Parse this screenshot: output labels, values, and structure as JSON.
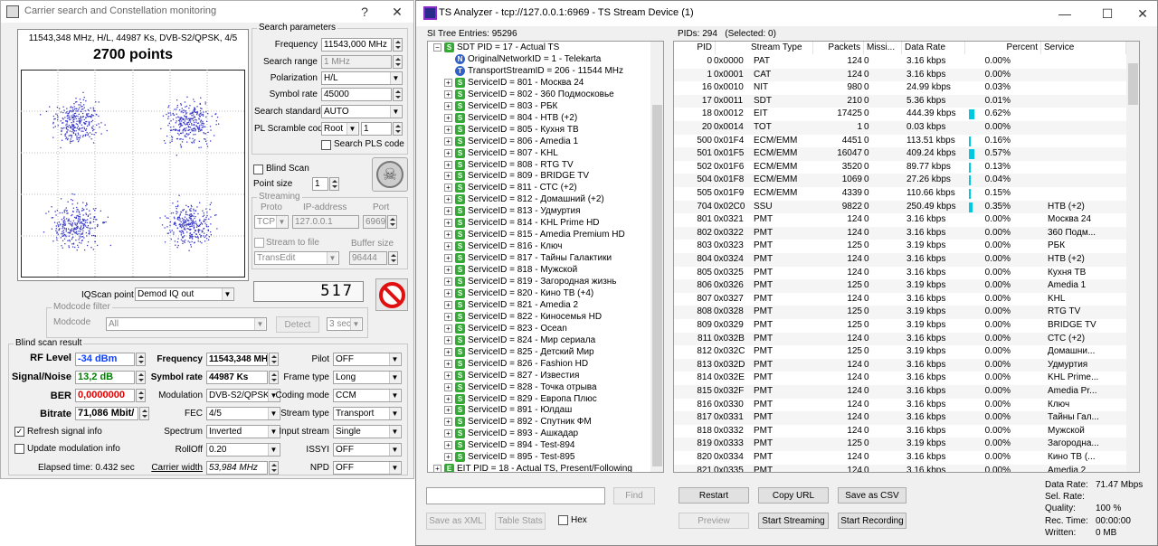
{
  "left": {
    "title": "Carrier search and Constellation monitoring",
    "help": "?",
    "close": "✕",
    "const_info": "11543,348 MHz, H/L, 44987 Ks, DVB-S2/QPSK, 4/5",
    "const_points": "2700 points",
    "search_title": "Search parameters",
    "freq_label": "Frequency",
    "freq_value": "11543,000 MHz",
    "range_label": "Search range",
    "range_value": "1 MHz",
    "pol_label": "Polarization",
    "pol_value": "H/L",
    "sr_label": "Symbol rate",
    "sr_value": "45000",
    "std_label": "Search standard",
    "std_value": "AUTO",
    "pls_label": "PL Scramble code",
    "pls_value": "Root",
    "pls_num": "1",
    "search_pls": "Search PLS code",
    "blind_scan": "Blind Scan",
    "point_size_label": "Point size",
    "point_size_value": "1",
    "streaming_title": "Streaming",
    "proto_label": "Proto",
    "ip_label": "IP-address",
    "port_label": "Port",
    "proto_value": "TCP",
    "ip_value": "127.0.0.1",
    "port_value": "6969",
    "stream_file": "Stream to file",
    "buffer_label": "Buffer size",
    "file_value": "TransEdit",
    "buffer_value": "96444",
    "iq_label": "IQScan point",
    "iq_value": "Demod IQ out",
    "counter": "517",
    "modcode_title": "Modcode filter",
    "modcode_label": "Modcode",
    "modcode_value": "All",
    "detect": "Detect",
    "sec_value": "3 sec",
    "blind_title": "Blind scan result",
    "rf_label": "RF Level",
    "rf_value": "-34 dBm",
    "sn_label": "Signal/Noise",
    "sn_value": "13,2 dB",
    "ber_label": "BER",
    "ber_value": "0,0000000",
    "bitrate_label": "Bitrate",
    "bitrate_value": "71,086 Mbit/",
    "bfreq_label": "Frequency",
    "bfreq_value": "11543,348 MH",
    "bsr_label": "Symbol rate",
    "bsr_value": "44987 Ks",
    "mod_label": "Modulation",
    "mod_value": "DVB-S2/QPSK",
    "fec_label": "FEC",
    "fec_value": "4/5",
    "spectrum_label": "Spectrum",
    "spectrum_value": "Inverted",
    "rolloff_label": "RollOff",
    "rolloff_value": "0.20",
    "cw_label": "Carrier width",
    "cw_value": "53,984 MHz",
    "pilot_label": "Pilot",
    "pilot_value": "OFF",
    "frame_label": "Frame type",
    "frame_value": "Long",
    "coding_label": "Coding mode",
    "coding_value": "CCM",
    "stype_label": "Stream type",
    "stype_value": "Transport",
    "istream_label": "Input stream",
    "istream_value": "Single",
    "issyi_label": "ISSYI",
    "issyi_value": "OFF",
    "npd_label": "NPD",
    "npd_value": "OFF",
    "refresh": "Refresh signal info",
    "update": "Update modulation info",
    "elapsed": "Elapsed time: 0.432 sec"
  },
  "right": {
    "title": "TS Analyzer - tcp://127.0.0.1:6969 - TS Stream Device (1)",
    "si_entries": "SI Tree Entries: 95296",
    "pids_info": "PIDs: 294   (Selected: 0)",
    "tree": [
      {
        "level": 0,
        "pm": "−",
        "icon": "S",
        "text": "SDT PID = 17 - Actual TS"
      },
      {
        "level": 1,
        "pm": "",
        "icon": "N",
        "text": "OriginalNetworkID = 1 - Telekarta"
      },
      {
        "level": 1,
        "pm": "",
        "icon": "T",
        "text": "TransportStreamID = 206 - 11544 MHz"
      },
      {
        "level": 1,
        "pm": "+",
        "icon": "S",
        "text": "ServiceID = 801 - Москва 24"
      },
      {
        "level": 1,
        "pm": "+",
        "icon": "S",
        "text": "ServiceID = 802 - 360 Подмосковье"
      },
      {
        "level": 1,
        "pm": "+",
        "icon": "S",
        "text": "ServiceID = 803 - РБК"
      },
      {
        "level": 1,
        "pm": "+",
        "icon": "S",
        "text": "ServiceID = 804 - НТВ (+2)"
      },
      {
        "level": 1,
        "pm": "+",
        "icon": "S",
        "text": "ServiceID = 805 - Кухня ТВ"
      },
      {
        "level": 1,
        "pm": "+",
        "icon": "S",
        "text": "ServiceID = 806 - Amedia 1"
      },
      {
        "level": 1,
        "pm": "+",
        "icon": "S",
        "text": "ServiceID = 807 - KHL"
      },
      {
        "level": 1,
        "pm": "+",
        "icon": "S",
        "text": "ServiceID = 808 - RTG TV"
      },
      {
        "level": 1,
        "pm": "+",
        "icon": "S",
        "text": "ServiceID = 809 - BRIDGE TV"
      },
      {
        "level": 1,
        "pm": "+",
        "icon": "S",
        "text": "ServiceID = 811 - СТС (+2)"
      },
      {
        "level": 1,
        "pm": "+",
        "icon": "S",
        "text": "ServiceID = 812 - Домашний (+2)"
      },
      {
        "level": 1,
        "pm": "+",
        "icon": "S",
        "text": "ServiceID = 813 - Удмуртия"
      },
      {
        "level": 1,
        "pm": "+",
        "icon": "S",
        "text": "ServiceID = 814 - KHL Prime HD"
      },
      {
        "level": 1,
        "pm": "+",
        "icon": "S",
        "text": "ServiceID = 815 - Amedia Premium HD"
      },
      {
        "level": 1,
        "pm": "+",
        "icon": "S",
        "text": "ServiceID = 816 - Ключ"
      },
      {
        "level": 1,
        "pm": "+",
        "icon": "S",
        "text": "ServiceID = 817 - Тайны Галактики"
      },
      {
        "level": 1,
        "pm": "+",
        "icon": "S",
        "text": "ServiceID = 818 - Мужской"
      },
      {
        "level": 1,
        "pm": "+",
        "icon": "S",
        "text": "ServiceID = 819 - Загородная жизнь"
      },
      {
        "level": 1,
        "pm": "+",
        "icon": "S",
        "text": "ServiceID = 820 - Кино ТВ (+4)"
      },
      {
        "level": 1,
        "pm": "+",
        "icon": "S",
        "text": "ServiceID = 821 - Amedia 2"
      },
      {
        "level": 1,
        "pm": "+",
        "icon": "S",
        "text": "ServiceID = 822 - Киносемья HD"
      },
      {
        "level": 1,
        "pm": "+",
        "icon": "S",
        "text": "ServiceID = 823 - Ocean"
      },
      {
        "level": 1,
        "pm": "+",
        "icon": "S",
        "text": "ServiceID = 824 - Мир сериала"
      },
      {
        "level": 1,
        "pm": "+",
        "icon": "S",
        "text": "ServiceID = 825 - Детский Мир"
      },
      {
        "level": 1,
        "pm": "+",
        "icon": "S",
        "text": "ServiceID = 826 - Fashion HD"
      },
      {
        "level": 1,
        "pm": "+",
        "icon": "S",
        "text": "ServiceID = 827 - Известия"
      },
      {
        "level": 1,
        "pm": "+",
        "icon": "S",
        "text": "ServiceID = 828 - Точка отрыва"
      },
      {
        "level": 1,
        "pm": "+",
        "icon": "S",
        "text": "ServiceID = 829 - Европа Плюс"
      },
      {
        "level": 1,
        "pm": "+",
        "icon": "S",
        "text": "ServiceID = 891 - Юлдаш"
      },
      {
        "level": 1,
        "pm": "+",
        "icon": "S",
        "text": "ServiceID = 892 - Спутник ФМ"
      },
      {
        "level": 1,
        "pm": "+",
        "icon": "S",
        "text": "ServiceID = 893 - Ашкадар"
      },
      {
        "level": 1,
        "pm": "+",
        "icon": "S",
        "text": "ServiceID = 894 - Test-894"
      },
      {
        "level": 1,
        "pm": "+",
        "icon": "S",
        "text": "ServiceID = 895 - Test-895"
      },
      {
        "level": 0,
        "pm": "+",
        "icon": "E",
        "text": "EIT PID = 18 - Actual TS, Present/Following"
      }
    ],
    "cols": [
      "PID",
      "",
      "Stream Type",
      "Packets",
      "Missi...",
      "Data Rate",
      "Percent",
      "Service"
    ],
    "rows": [
      [
        "0",
        "0x0000",
        "PAT",
        "124",
        "0",
        "3.16 kbps",
        "0.00%",
        "",
        0
      ],
      [
        "1",
        "0x0001",
        "CAT",
        "124",
        "0",
        "3.16 kbps",
        "0.00%",
        "",
        0
      ],
      [
        "16",
        "0x0010",
        "NIT",
        "980",
        "0",
        "24.99 kbps",
        "0.03%",
        "",
        0
      ],
      [
        "17",
        "0x0011",
        "SDT",
        "210",
        "0",
        "5.36 kbps",
        "0.01%",
        "",
        0
      ],
      [
        "18",
        "0x0012",
        "EIT",
        "17425",
        "0",
        "444.39 kbps",
        "0.62%",
        "",
        0.62
      ],
      [
        "20",
        "0x0014",
        "TOT",
        "1",
        "0",
        "0.03 kbps",
        "0.00%",
        "",
        0
      ],
      [
        "500",
        "0x01F4",
        "ECM/EMM",
        "4451",
        "0",
        "113.51 kbps",
        "0.16%",
        "",
        0.16
      ],
      [
        "501",
        "0x01F5",
        "ECM/EMM",
        "16047",
        "0",
        "409.24 kbps",
        "0.57%",
        "",
        0.57
      ],
      [
        "502",
        "0x01F6",
        "ECM/EMM",
        "3520",
        "0",
        "89.77 kbps",
        "0.13%",
        "",
        0.13
      ],
      [
        "504",
        "0x01F8",
        "ECM/EMM",
        "1069",
        "0",
        "27.26 kbps",
        "0.04%",
        "",
        0.04
      ],
      [
        "505",
        "0x01F9",
        "ECM/EMM",
        "4339",
        "0",
        "110.66 kbps",
        "0.15%",
        "",
        0.15
      ],
      [
        "704",
        "0x02C0",
        "SSU",
        "9822",
        "0",
        "250.49 kbps",
        "0.35%",
        "НТВ (+2)",
        0.35
      ],
      [
        "801",
        "0x0321",
        "PMT",
        "124",
        "0",
        "3.16 kbps",
        "0.00%",
        "Москва 24",
        0
      ],
      [
        "802",
        "0x0322",
        "PMT",
        "124",
        "0",
        "3.16 kbps",
        "0.00%",
        "360 Подм...",
        0
      ],
      [
        "803",
        "0x0323",
        "PMT",
        "125",
        "0",
        "3.19 kbps",
        "0.00%",
        "РБК",
        0
      ],
      [
        "804",
        "0x0324",
        "PMT",
        "124",
        "0",
        "3.16 kbps",
        "0.00%",
        "НТВ (+2)",
        0
      ],
      [
        "805",
        "0x0325",
        "PMT",
        "124",
        "0",
        "3.16 kbps",
        "0.00%",
        "Кухня ТВ",
        0
      ],
      [
        "806",
        "0x0326",
        "PMT",
        "125",
        "0",
        "3.19 kbps",
        "0.00%",
        "Amedia 1",
        0
      ],
      [
        "807",
        "0x0327",
        "PMT",
        "124",
        "0",
        "3.16 kbps",
        "0.00%",
        "KHL",
        0
      ],
      [
        "808",
        "0x0328",
        "PMT",
        "125",
        "0",
        "3.19 kbps",
        "0.00%",
        "RTG TV",
        0
      ],
      [
        "809",
        "0x0329",
        "PMT",
        "125",
        "0",
        "3.19 kbps",
        "0.00%",
        "BRIDGE TV",
        0
      ],
      [
        "811",
        "0x032B",
        "PMT",
        "124",
        "0",
        "3.16 kbps",
        "0.00%",
        "СТС (+2)",
        0
      ],
      [
        "812",
        "0x032C",
        "PMT",
        "125",
        "0",
        "3.19 kbps",
        "0.00%",
        "Домашни...",
        0
      ],
      [
        "813",
        "0x032D",
        "PMT",
        "124",
        "0",
        "3.16 kbps",
        "0.00%",
        "Удмуртия",
        0
      ],
      [
        "814",
        "0x032E",
        "PMT",
        "124",
        "0",
        "3.16 kbps",
        "0.00%",
        "KHL Prime...",
        0
      ],
      [
        "815",
        "0x032F",
        "PMT",
        "124",
        "0",
        "3.16 kbps",
        "0.00%",
        "Amedia Pr...",
        0
      ],
      [
        "816",
        "0x0330",
        "PMT",
        "124",
        "0",
        "3.16 kbps",
        "0.00%",
        "Ключ",
        0
      ],
      [
        "817",
        "0x0331",
        "PMT",
        "124",
        "0",
        "3.16 kbps",
        "0.00%",
        "Тайны Гал...",
        0
      ],
      [
        "818",
        "0x0332",
        "PMT",
        "124",
        "0",
        "3.16 kbps",
        "0.00%",
        "Мужской",
        0
      ],
      [
        "819",
        "0x0333",
        "PMT",
        "125",
        "0",
        "3.19 kbps",
        "0.00%",
        "Загородна...",
        0
      ],
      [
        "820",
        "0x0334",
        "PMT",
        "124",
        "0",
        "3.16 kbps",
        "0.00%",
        "Кино ТВ (...",
        0
      ],
      [
        "821",
        "0x0335",
        "PMT",
        "124",
        "0",
        "3.16 kbps",
        "0.00%",
        "Amedia 2",
        0
      ]
    ],
    "find": "Find",
    "save_xml": "Save as XML",
    "table_stats": "Table Stats",
    "hex": "Hex",
    "restart": "Restart",
    "copy_url": "Copy URL",
    "save_csv": "Save as CSV",
    "preview": "Preview",
    "start_streaming": "Start Streaming",
    "start_recording": "Start Recording",
    "stats": [
      [
        "Data Rate:",
        "71.47 Mbps"
      ],
      [
        "Sel. Rate:",
        ""
      ],
      [
        "Quality:",
        "100 %"
      ],
      [
        "Rec. Time:",
        "00:00:00"
      ],
      [
        "Written:",
        "0 MB"
      ]
    ],
    "min": "—",
    "max": "☐",
    "close": "✕"
  },
  "colors": {
    "accent_cyan": "#00c8e0",
    "rf_blue": "#1040ff",
    "sn_green": "#008000",
    "ber_red": "#e00000",
    "dot": "#3a3ac8"
  }
}
